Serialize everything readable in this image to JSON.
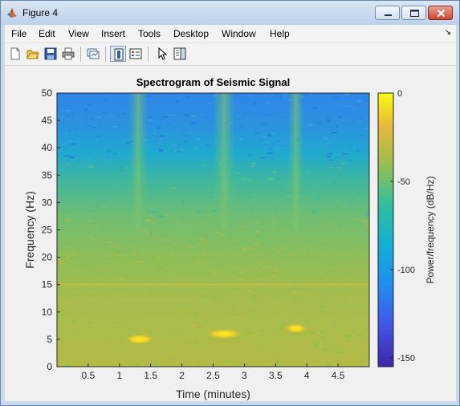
{
  "window": {
    "title": "Figure 4",
    "app_icon": "matlab-icon"
  },
  "menu": {
    "items": [
      "File",
      "Edit",
      "View",
      "Insert",
      "Tools",
      "Desktop",
      "Window",
      "Help"
    ],
    "overflow_icon": "dock-arrow-icon"
  },
  "toolbar": {
    "tools": [
      "new-figure-icon",
      "open-file-icon",
      "save-icon",
      "print-icon",
      "link-plot-icon",
      "colorbar-icon",
      "legend-icon",
      "edit-plot-icon",
      "property-editor-icon"
    ]
  },
  "colors": {
    "title_bar": "#c6d8ee",
    "close_button": "#c9452f",
    "low_power": "#3e26a8",
    "high_power": "#f9fb0e"
  },
  "chart_data": {
    "type": "heatmap",
    "title": "Spectrogram of Seismic Signal",
    "xlabel": "Time (minutes)",
    "ylabel": "Frequency (Hz)",
    "xlim": [
      0,
      5
    ],
    "ylim": [
      0,
      50
    ],
    "xticks": [
      0.5,
      1,
      1.5,
      2,
      2.5,
      3,
      3.5,
      4,
      4.5
    ],
    "xtick_labels": [
      "0.5",
      "1",
      "1.5",
      "2",
      "2.5",
      "3",
      "3.5",
      "4",
      "4.5"
    ],
    "yticks": [
      0,
      5,
      10,
      15,
      20,
      25,
      30,
      35,
      40,
      45,
      50
    ],
    "ytick_labels": [
      "0",
      "5",
      "10",
      "15",
      "20",
      "25",
      "30",
      "35",
      "40",
      "45",
      "50"
    ],
    "colorbar": {
      "label": "Power/frequency (dB/Hz)",
      "range": [
        -155,
        0
      ],
      "ticks": [
        0,
        -50,
        -100,
        -150
      ],
      "tick_labels": [
        "0",
        "-50",
        "-100",
        "-150"
      ],
      "colormap": "parula"
    },
    "events": [
      {
        "time_start": 1.1,
        "time_end": 1.55,
        "freq": 5,
        "power_db": 0
      },
      {
        "time_start": 2.4,
        "time_end": 2.95,
        "freq": 6,
        "power_db": 0
      },
      {
        "time_start": 3.65,
        "time_end": 4.0,
        "freq": 7,
        "power_db": -5
      }
    ],
    "vertical_bands": [
      {
        "time_start": 1.15,
        "time_end": 1.45
      },
      {
        "time_start": 2.5,
        "time_end": 2.85
      },
      {
        "time_start": 3.7,
        "time_end": 3.95
      }
    ],
    "harmonic_line_freq": 15,
    "grid": false
  }
}
